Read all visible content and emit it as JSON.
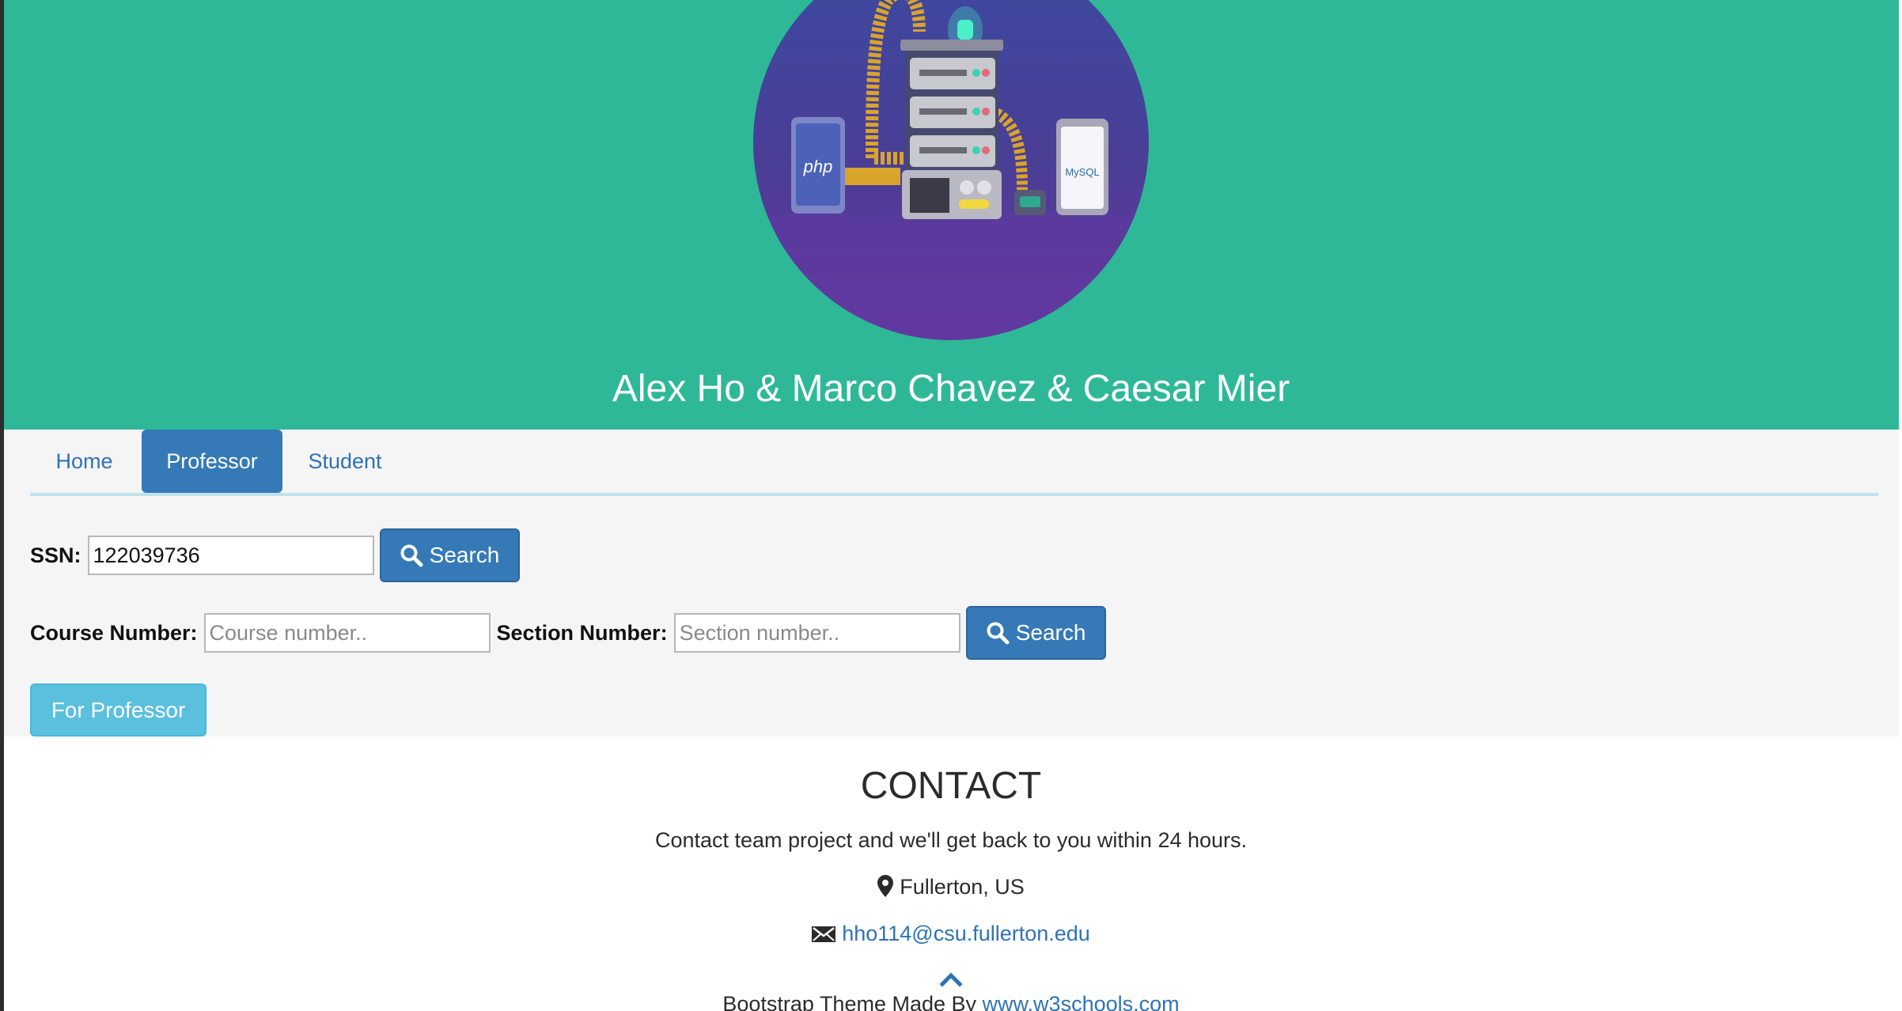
{
  "header": {
    "team_title": "Alex Ho & Marco Chavez & Caesar Mier",
    "logo_labels": {
      "php": "php",
      "mysql": "MySQL"
    }
  },
  "tabs": [
    {
      "label": "Home",
      "active": false
    },
    {
      "label": "Professor",
      "active": true
    },
    {
      "label": "Student",
      "active": false
    }
  ],
  "ssn_form": {
    "label": "SSN:",
    "value": "122039736",
    "button_label": "Search",
    "button_icon": "search-icon"
  },
  "course_form": {
    "course_label": "Course Number:",
    "course_placeholder": "Course number..",
    "section_label": "Section Number:",
    "section_placeholder": "Section number..",
    "button_label": "Search",
    "button_icon": "search-icon"
  },
  "for_professor_label": "For Professor",
  "contact": {
    "title": "CONTACT",
    "description": "Contact team project and we'll get back to you within 24 hours.",
    "location": "Fullerton, US",
    "location_icon": "map-marker-icon",
    "email": "hho114@csu.fullerton.edu",
    "email_icon": "envelope-icon"
  },
  "footer": {
    "scroll_up_icon": "chevron-up-icon",
    "credit_prefix": "Bootstrap Theme Made By",
    "credit_link": "www.w3schools.com"
  },
  "colors": {
    "header_bg": "#2eb898",
    "primary": "#357ab7",
    "info": "#5bc0de",
    "panel_bg": "#f5f5f5",
    "link": "#2f72b6"
  }
}
